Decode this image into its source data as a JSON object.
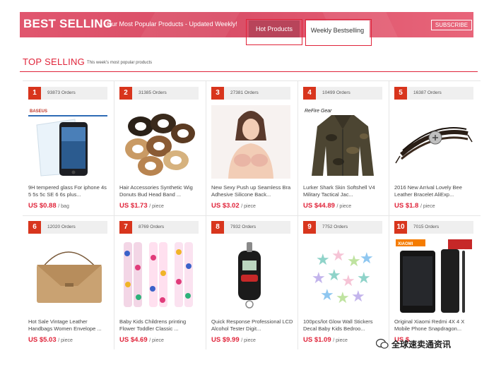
{
  "header": {
    "title": "BEST SELLING",
    "subtitle": "Our Most Popular Products - Updated Weekly!",
    "tabs": [
      {
        "label": "Hot Products",
        "active": true
      },
      {
        "label": "Weekly Bestselling",
        "active": false
      }
    ],
    "subscribe_label": "SUBSCRIBE",
    "accent_color": "#d94e67"
  },
  "section": {
    "title": "TOP SELLING",
    "subtitle": "This week's most popular products",
    "accent_color": "#e0243a"
  },
  "products": [
    {
      "rank": "1",
      "orders": "93873 Orders",
      "title": "9H tempered glass For iphone 4s 5 5s 5c SE 6 6s plus...",
      "price": "US $0.88",
      "unit": "/ bag",
      "image": "phone-screen-protector",
      "brand": "BASEUS"
    },
    {
      "rank": "2",
      "orders": "31385 Orders",
      "title": "Hair Accessories Synthetic Wig Donuts Bud Head Band ...",
      "price": "US $1.73",
      "unit": "/ piece",
      "image": "hair-donut-bands",
      "brand": ""
    },
    {
      "rank": "3",
      "orders": "27381 Orders",
      "title": "New Sexy Push up Seamless Bra Adhesive Silicone Back...",
      "price": "US $3.02",
      "unit": "/ piece",
      "image": "silicone-bra-model",
      "brand": ""
    },
    {
      "rank": "4",
      "orders": "10499 Orders",
      "title": "Lurker Shark Skin Softshell V4 Military Tactical Jac...",
      "price": "US $44.89",
      "unit": "/ piece",
      "image": "camo-tactical-jacket",
      "brand": "ReFire Gear"
    },
    {
      "rank": "5",
      "orders": "16387 Orders",
      "title": "2016 New Arrival Lovely Bee Leather Bracelet AliExp...",
      "price": "US $1.8",
      "unit": "/ piece",
      "image": "leather-bracelet",
      "brand": ""
    },
    {
      "rank": "6",
      "orders": "12020 Orders",
      "title": "Hot Sale Vintage Leather Handbags Women Envelope ...",
      "price": "US $5.03",
      "unit": "/ piece",
      "image": "envelope-handbag",
      "brand": ""
    },
    {
      "rank": "7",
      "orders": "8769 Orders",
      "title": "Baby Kids Childrens printing Flower Toddler Classic ...",
      "price": "US $4.69",
      "unit": "/ piece",
      "image": "kids-floral-leggings",
      "brand": ""
    },
    {
      "rank": "8",
      "orders": "7932 Orders",
      "title": "Quick Response Professional LCD Alcohol Tester Digit...",
      "price": "US $9.99",
      "unit": "/ piece",
      "image": "alcohol-tester",
      "brand": ""
    },
    {
      "rank": "9",
      "orders": "7752 Orders",
      "title": "100pcs/lot Glow Wall Stickers Decal Baby Kids Bedroo...",
      "price": "US $1.09",
      "unit": "/ piece",
      "image": "glow-star-stickers",
      "brand": ""
    },
    {
      "rank": "10",
      "orders": "7015 Orders",
      "title": "Original Xiaomi Redmi 4X 4 X Mobile Phone Snapdragon...",
      "price": "US $",
      "unit": "",
      "image": "xiaomi-phone",
      "brand": "XIAOMI"
    }
  ],
  "watermark": {
    "text": "全球速卖通资讯"
  }
}
